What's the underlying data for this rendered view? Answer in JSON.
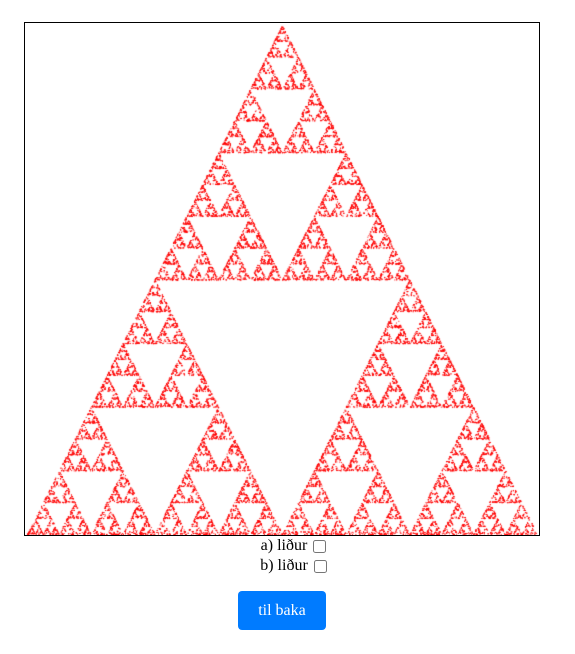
{
  "options": [
    {
      "label": "a) liður",
      "checked": false
    },
    {
      "label": "b) liður",
      "checked": false
    }
  ],
  "back_button": {
    "label": "til baka"
  },
  "colors": {
    "fractal_point": "#ff0000",
    "canvas_border": "#000000",
    "button_background": "#007bff",
    "button_text": "#ffffff"
  }
}
